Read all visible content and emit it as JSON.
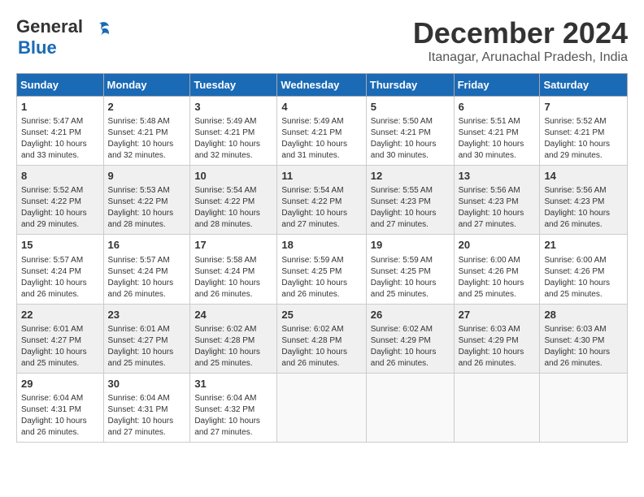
{
  "header": {
    "logo_line1": "General",
    "logo_line2": "Blue",
    "month_title": "December 2024",
    "location": "Itanagar, Arunachal Pradesh, India"
  },
  "weekdays": [
    "Sunday",
    "Monday",
    "Tuesday",
    "Wednesday",
    "Thursday",
    "Friday",
    "Saturday"
  ],
  "weeks": [
    [
      {
        "day": "1",
        "info": "Sunrise: 5:47 AM\nSunset: 4:21 PM\nDaylight: 10 hours and 33 minutes."
      },
      {
        "day": "2",
        "info": "Sunrise: 5:48 AM\nSunset: 4:21 PM\nDaylight: 10 hours and 32 minutes."
      },
      {
        "day": "3",
        "info": "Sunrise: 5:49 AM\nSunset: 4:21 PM\nDaylight: 10 hours and 32 minutes."
      },
      {
        "day": "4",
        "info": "Sunrise: 5:49 AM\nSunset: 4:21 PM\nDaylight: 10 hours and 31 minutes."
      },
      {
        "day": "5",
        "info": "Sunrise: 5:50 AM\nSunset: 4:21 PM\nDaylight: 10 hours and 30 minutes."
      },
      {
        "day": "6",
        "info": "Sunrise: 5:51 AM\nSunset: 4:21 PM\nDaylight: 10 hours and 30 minutes."
      },
      {
        "day": "7",
        "info": "Sunrise: 5:52 AM\nSunset: 4:21 PM\nDaylight: 10 hours and 29 minutes."
      }
    ],
    [
      {
        "day": "8",
        "info": "Sunrise: 5:52 AM\nSunset: 4:22 PM\nDaylight: 10 hours and 29 minutes."
      },
      {
        "day": "9",
        "info": "Sunrise: 5:53 AM\nSunset: 4:22 PM\nDaylight: 10 hours and 28 minutes."
      },
      {
        "day": "10",
        "info": "Sunrise: 5:54 AM\nSunset: 4:22 PM\nDaylight: 10 hours and 28 minutes."
      },
      {
        "day": "11",
        "info": "Sunrise: 5:54 AM\nSunset: 4:22 PM\nDaylight: 10 hours and 27 minutes."
      },
      {
        "day": "12",
        "info": "Sunrise: 5:55 AM\nSunset: 4:23 PM\nDaylight: 10 hours and 27 minutes."
      },
      {
        "day": "13",
        "info": "Sunrise: 5:56 AM\nSunset: 4:23 PM\nDaylight: 10 hours and 27 minutes."
      },
      {
        "day": "14",
        "info": "Sunrise: 5:56 AM\nSunset: 4:23 PM\nDaylight: 10 hours and 26 minutes."
      }
    ],
    [
      {
        "day": "15",
        "info": "Sunrise: 5:57 AM\nSunset: 4:24 PM\nDaylight: 10 hours and 26 minutes."
      },
      {
        "day": "16",
        "info": "Sunrise: 5:57 AM\nSunset: 4:24 PM\nDaylight: 10 hours and 26 minutes."
      },
      {
        "day": "17",
        "info": "Sunrise: 5:58 AM\nSunset: 4:24 PM\nDaylight: 10 hours and 26 minutes."
      },
      {
        "day": "18",
        "info": "Sunrise: 5:59 AM\nSunset: 4:25 PM\nDaylight: 10 hours and 26 minutes."
      },
      {
        "day": "19",
        "info": "Sunrise: 5:59 AM\nSunset: 4:25 PM\nDaylight: 10 hours and 25 minutes."
      },
      {
        "day": "20",
        "info": "Sunrise: 6:00 AM\nSunset: 4:26 PM\nDaylight: 10 hours and 25 minutes."
      },
      {
        "day": "21",
        "info": "Sunrise: 6:00 AM\nSunset: 4:26 PM\nDaylight: 10 hours and 25 minutes."
      }
    ],
    [
      {
        "day": "22",
        "info": "Sunrise: 6:01 AM\nSunset: 4:27 PM\nDaylight: 10 hours and 25 minutes."
      },
      {
        "day": "23",
        "info": "Sunrise: 6:01 AM\nSunset: 4:27 PM\nDaylight: 10 hours and 25 minutes."
      },
      {
        "day": "24",
        "info": "Sunrise: 6:02 AM\nSunset: 4:28 PM\nDaylight: 10 hours and 25 minutes."
      },
      {
        "day": "25",
        "info": "Sunrise: 6:02 AM\nSunset: 4:28 PM\nDaylight: 10 hours and 26 minutes."
      },
      {
        "day": "26",
        "info": "Sunrise: 6:02 AM\nSunset: 4:29 PM\nDaylight: 10 hours and 26 minutes."
      },
      {
        "day": "27",
        "info": "Sunrise: 6:03 AM\nSunset: 4:29 PM\nDaylight: 10 hours and 26 minutes."
      },
      {
        "day": "28",
        "info": "Sunrise: 6:03 AM\nSunset: 4:30 PM\nDaylight: 10 hours and 26 minutes."
      }
    ],
    [
      {
        "day": "29",
        "info": "Sunrise: 6:04 AM\nSunset: 4:31 PM\nDaylight: 10 hours and 26 minutes."
      },
      {
        "day": "30",
        "info": "Sunrise: 6:04 AM\nSunset: 4:31 PM\nDaylight: 10 hours and 27 minutes."
      },
      {
        "day": "31",
        "info": "Sunrise: 6:04 AM\nSunset: 4:32 PM\nDaylight: 10 hours and 27 minutes."
      },
      null,
      null,
      null,
      null
    ]
  ]
}
